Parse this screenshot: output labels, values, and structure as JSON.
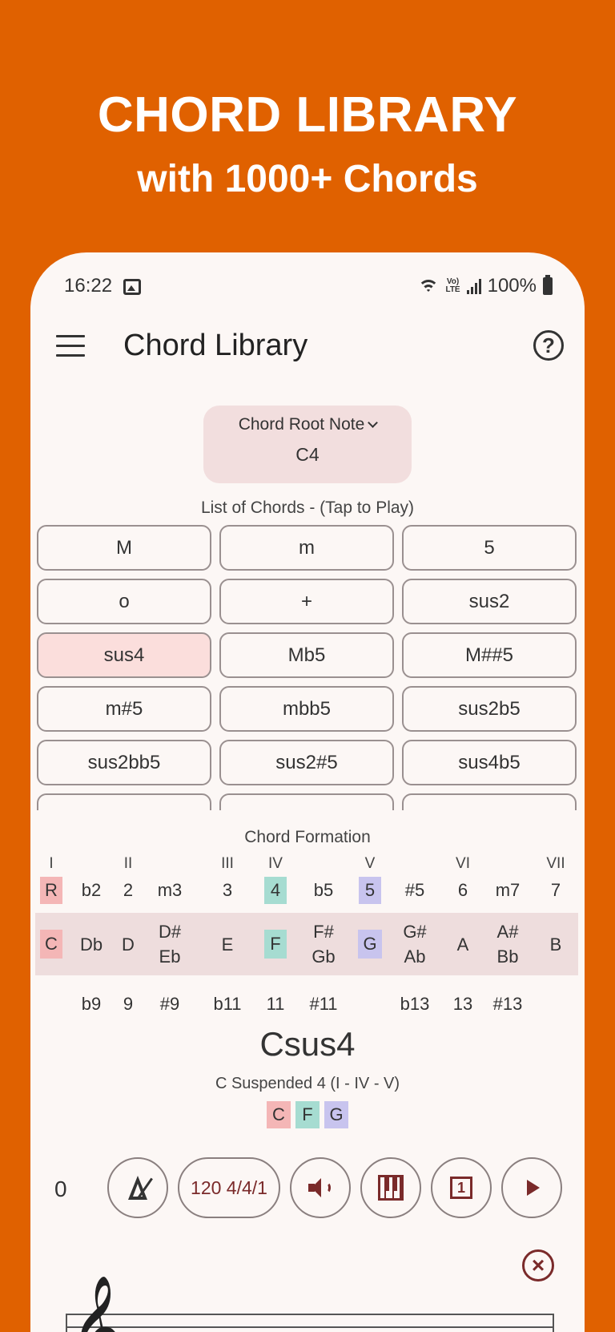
{
  "promo": {
    "title": "CHORD LIBRARY",
    "subtitle": "with 1000+ Chords"
  },
  "status_bar": {
    "time": "16:22",
    "volte": "Vo) LTE",
    "battery": "100%"
  },
  "app_bar": {
    "title": "Chord Library",
    "help": "?"
  },
  "root_selector": {
    "label": "Chord Root Note",
    "value": "C4"
  },
  "chord_list": {
    "title": "List of Chords - (Tap to Play)",
    "chords": [
      "M",
      "m",
      "5",
      "o",
      "+",
      "sus2",
      "sus4",
      "Mb5",
      "M##5",
      "m#5",
      "mbb5",
      "sus2b5",
      "sus2bb5",
      "sus2#5",
      "sus4b5"
    ],
    "selected": "sus4"
  },
  "formation": {
    "title": "Chord Formation",
    "roman": [
      "I",
      "II",
      "III",
      "IV",
      "V",
      "VI",
      "VII"
    ],
    "degrees": [
      "R",
      "b2",
      "2",
      "m3",
      "3",
      "4",
      "b5",
      "5",
      "#5",
      "6",
      "m7",
      "7"
    ],
    "notes": [
      [
        "C"
      ],
      [
        "Db"
      ],
      [
        "D"
      ],
      [
        "D#",
        "Eb"
      ],
      [
        "E"
      ],
      [
        "F"
      ],
      [
        "F#",
        "Gb"
      ],
      [
        "G"
      ],
      [
        "G#",
        "Ab"
      ],
      [
        "A"
      ],
      [
        "A#",
        "Bb"
      ],
      [
        "B"
      ]
    ],
    "extensions": [
      "b9",
      "9",
      "#9",
      "b11",
      "11",
      "#11",
      "b13",
      "13",
      "#13"
    ]
  },
  "chord_info": {
    "name": "Csus4",
    "description": "C Suspended 4 (I - IV - V)",
    "notes": [
      "C",
      "F",
      "G"
    ]
  },
  "controls": {
    "counter": "0",
    "tempo": "120 4/4/1",
    "one": "1"
  },
  "colors": {
    "background": "#E06100",
    "highlight_root": "#F4B6B6",
    "highlight_fourth": "#A6DCD1",
    "highlight_fifth": "#C8C4EE",
    "accent": "#7A2A2A"
  }
}
